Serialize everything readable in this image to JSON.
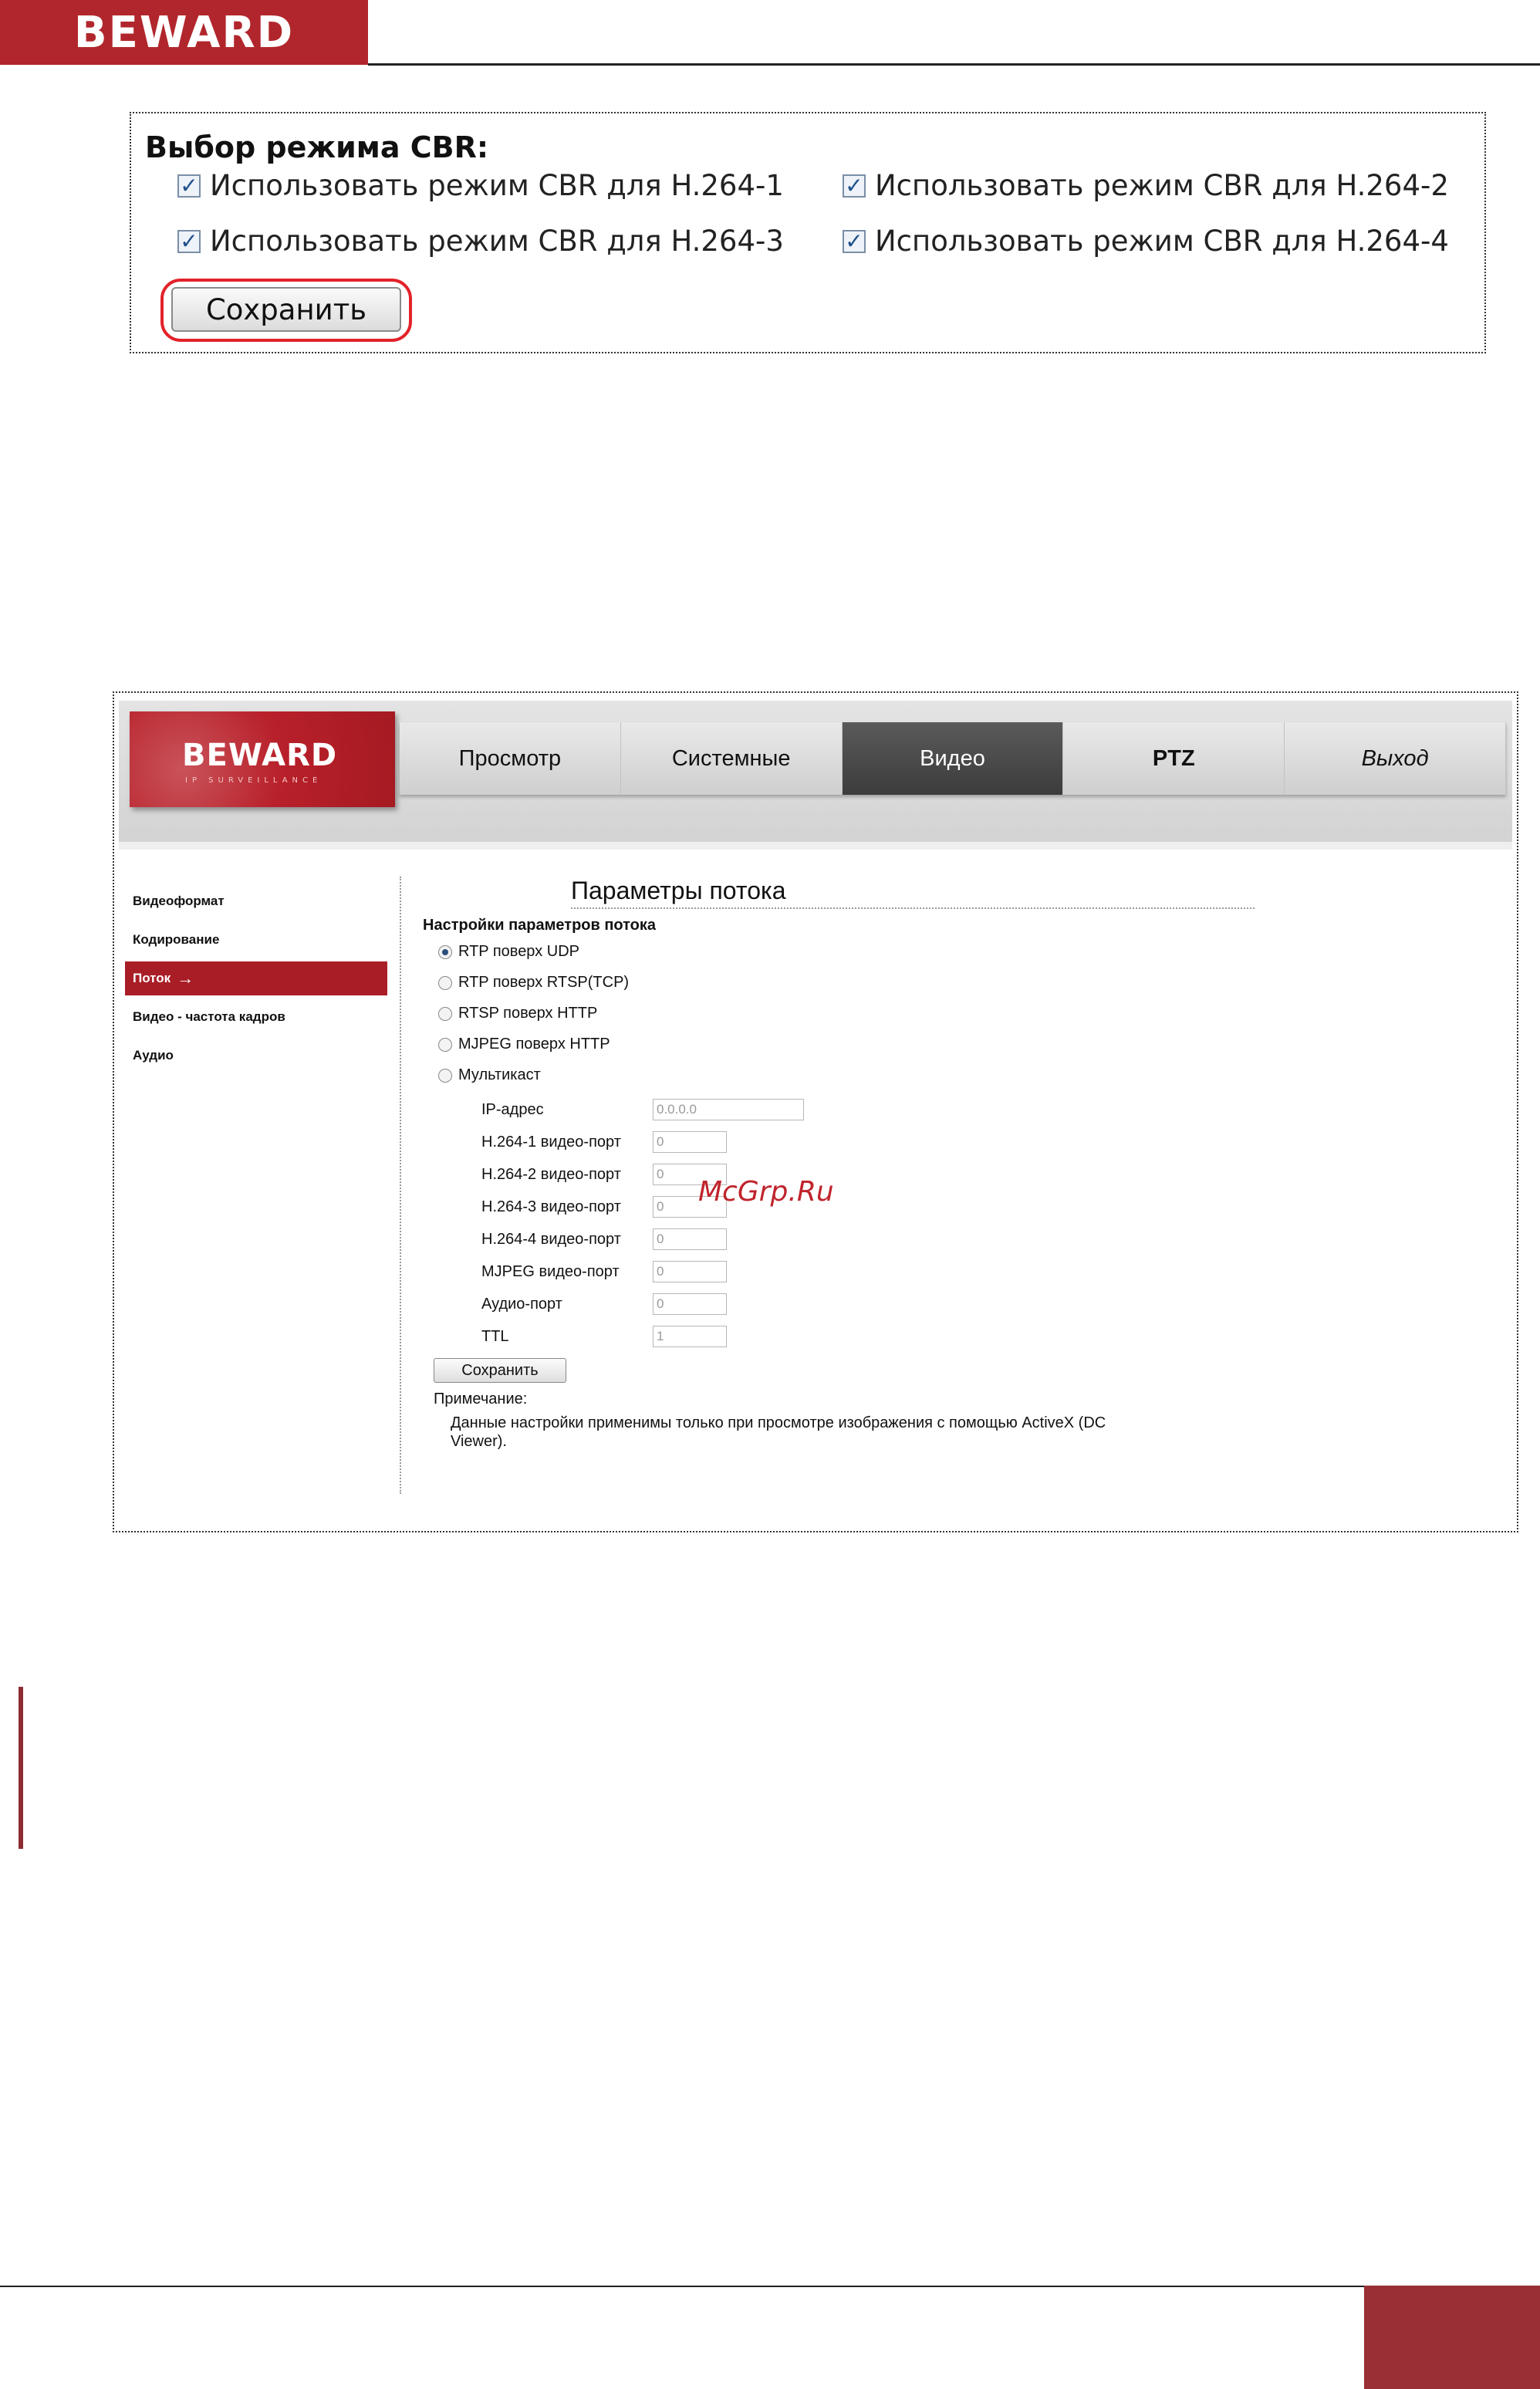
{
  "page_header": {
    "logo_text": "BEWARD"
  },
  "cbr": {
    "title": "Выбор режима CBR:",
    "items": [
      {
        "label": "Использовать режим CBR для H.264-1",
        "checked": true
      },
      {
        "label": "Использовать режим CBR для H.264-2",
        "checked": true
      },
      {
        "label": "Использовать режим CBR для H.264-3",
        "checked": true
      },
      {
        "label": "Использовать режим CBR для H.264-4",
        "checked": true
      }
    ],
    "save_label": "Сохранить",
    "highlight_color": "#e3222a"
  },
  "app": {
    "logo_text": "BEWARD",
    "logo_sub": "IP SURVEILLANCE",
    "menu": [
      "Просмотр",
      "Системные",
      "Видео",
      "PTZ",
      "Выход"
    ],
    "menu_active": "Видео",
    "sidebar": [
      "Видеоформат",
      "Кодирование",
      "Поток",
      "Видео - частота кадров",
      "Аудио"
    ],
    "sidebar_active": "Поток",
    "sidebar_arrow": "→",
    "title": "Параметры потока",
    "subtitle": "Настройки параметров потока",
    "radios": [
      {
        "label": "RTP поверх UDP",
        "selected": true
      },
      {
        "label": "RTP поверх RTSP(TCP)",
        "selected": false
      },
      {
        "label": "RTSP поверх HTTP",
        "selected": false
      },
      {
        "label": "MJPEG поверх HTTP",
        "selected": false
      },
      {
        "label": "Мультикаст",
        "selected": false
      }
    ],
    "fields": [
      {
        "label": "IP-адрес",
        "value": "0.0.0.0"
      },
      {
        "label": "H.264-1 видео-порт",
        "value": "0"
      },
      {
        "label": "H.264-2 видео-порт",
        "value": "0"
      },
      {
        "label": "H.264-3 видео-порт",
        "value": "0"
      },
      {
        "label": "H.264-4 видео-порт",
        "value": "0"
      },
      {
        "label": "MJPEG видео-порт",
        "value": "0"
      },
      {
        "label": "Аудио-порт",
        "value": "0"
      },
      {
        "label": "TTL",
        "value": "1"
      }
    ],
    "save_label": "Сохранить",
    "note_label": "Примечание:",
    "note_text": "Данные настройки применимы только при просмотре изображения с помощью ActiveX (DC Viewer)."
  },
  "watermark": "McGrp.Ru",
  "colors": {
    "brand_red": "#b1262c",
    "footer_red": "#9a3036",
    "active_tab": "#4a4a4a"
  }
}
